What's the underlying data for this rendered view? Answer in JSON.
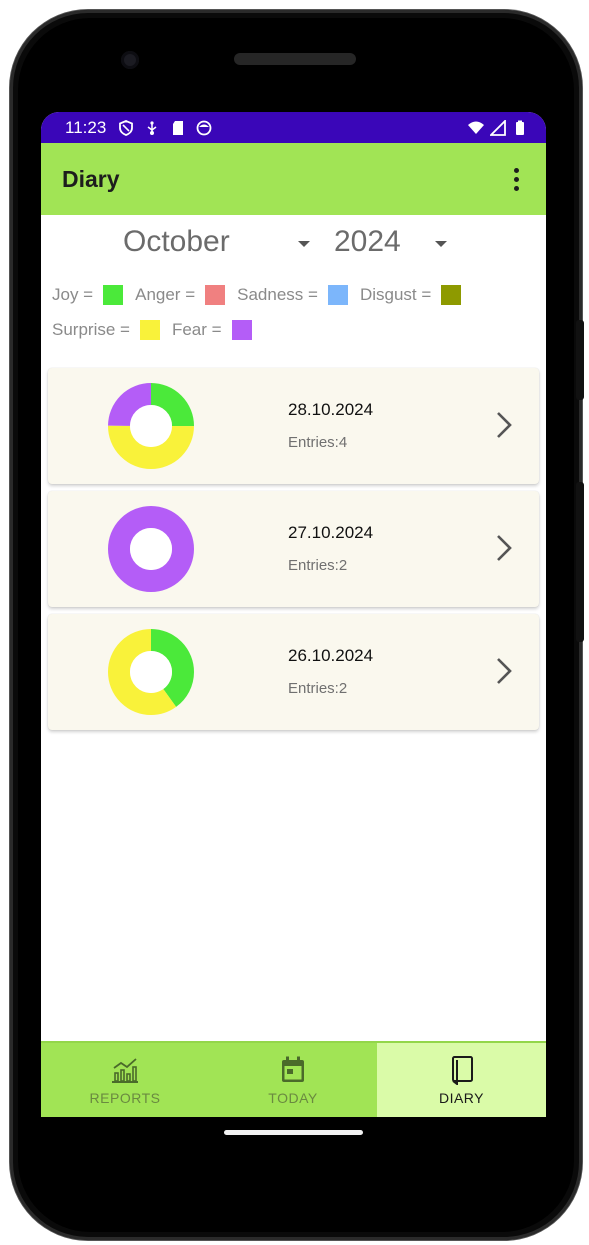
{
  "status_bar": {
    "time": "11:23",
    "left_icons": [
      "shield-icon",
      "usb-icon",
      "sd-card-icon",
      "face-icon"
    ],
    "right_icons": [
      "wifi-icon",
      "signal-icon",
      "battery-icon"
    ]
  },
  "app_bar": {
    "title": "Diary",
    "menu_icon": "more-vert-icon"
  },
  "filters": {
    "month": "October",
    "year": "2024"
  },
  "legend": {
    "joy": {
      "label": "Joy =",
      "color": "#4be93a"
    },
    "anger": {
      "label": "Anger =",
      "color": "#f08080"
    },
    "sadness": {
      "label": "Sadness =",
      "color": "#7cb6fb"
    },
    "disgust": {
      "label": "Disgust =",
      "color": "#8e9a00"
    },
    "surprise": {
      "label": "Surprise =",
      "color": "#f9f23a"
    },
    "fear": {
      "label": "Fear =",
      "color": "#b45df7"
    }
  },
  "entries": [
    {
      "date": "28.10.2024",
      "entries_label": "Entries:4",
      "slices": [
        {
          "emotion": "joy",
          "value": 1
        },
        {
          "emotion": "surprise",
          "value": 2
        },
        {
          "emotion": "fear",
          "value": 1
        }
      ]
    },
    {
      "date": "27.10.2024",
      "entries_label": "Entries:2",
      "slices": [
        {
          "emotion": "fear",
          "value": 2
        }
      ]
    },
    {
      "date": "26.10.2024",
      "entries_label": "Entries:2",
      "slices": [
        {
          "emotion": "joy",
          "value": 0.8
        },
        {
          "emotion": "surprise",
          "value": 1.2
        }
      ]
    }
  ],
  "bottom_nav": {
    "reports": {
      "label": "REPORTS",
      "icon": "chart-icon"
    },
    "today": {
      "label": "TODAY",
      "icon": "calendar-icon"
    },
    "diary": {
      "label": "DIARY",
      "icon": "book-icon",
      "active": true
    }
  },
  "colors": {
    "status_bar": "#3a06b8",
    "app_bar": "#a1e455",
    "nav_active": "#dafba8",
    "card_bg": "#faf8ee"
  }
}
